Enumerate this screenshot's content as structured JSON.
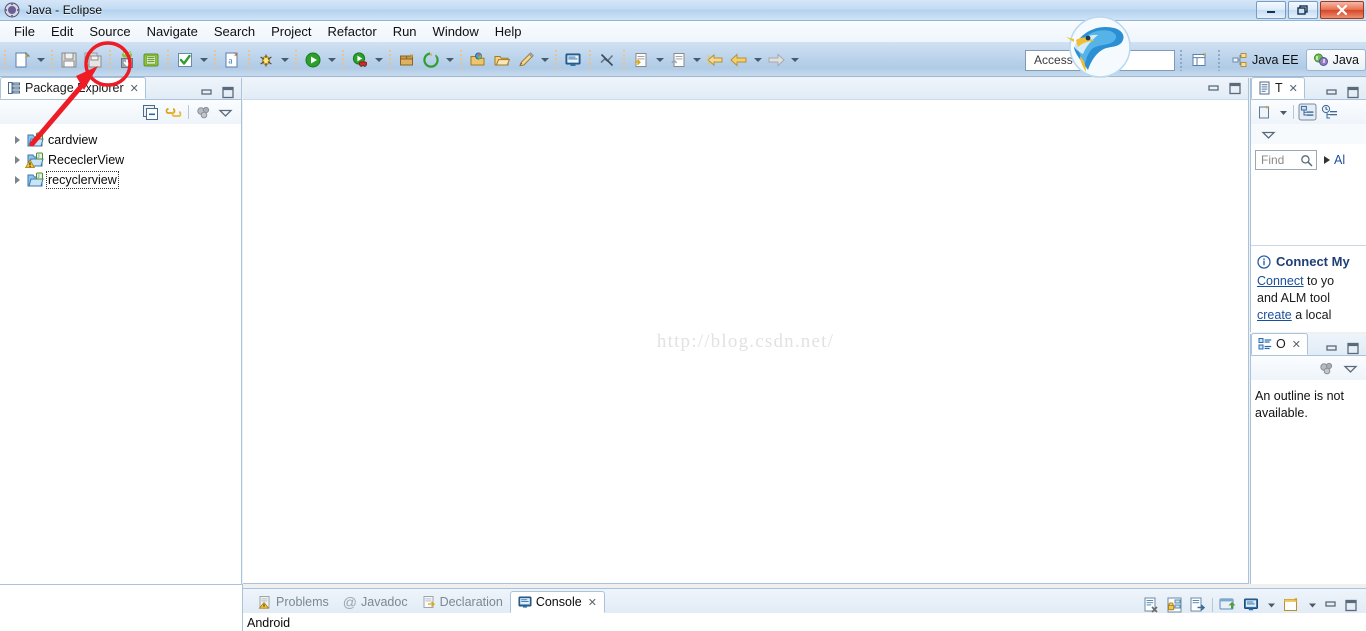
{
  "window": {
    "title": "Java - Eclipse",
    "icon": "eclipse-icon",
    "controls": {
      "minimize": "—",
      "restore": "❐",
      "close": "✕"
    }
  },
  "menubar": {
    "items": [
      {
        "label": "File"
      },
      {
        "label": "Edit"
      },
      {
        "label": "Source"
      },
      {
        "label": "Navigate"
      },
      {
        "label": "Search"
      },
      {
        "label": "Project"
      },
      {
        "label": "Refactor"
      },
      {
        "label": "Run"
      },
      {
        "label": "Window"
      },
      {
        "label": "Help"
      }
    ]
  },
  "toolbar": {
    "buttons": [
      {
        "name": "new-wizard-icon",
        "tooltip": "New"
      },
      {
        "name": "new-dropdown-arrow",
        "tooltip": "New menu"
      },
      {
        "name": "save-icon",
        "tooltip": "Save"
      },
      {
        "name": "save-all-icon",
        "tooltip": "Save All"
      },
      {
        "name": "android-sdk-manager-icon",
        "tooltip": "Android SDK Manager",
        "highlighted": true
      },
      {
        "name": "android-virtual-device-manager-icon",
        "tooltip": "Android Virtual Device Manager"
      },
      {
        "name": "build-all-icon",
        "tooltip": "Build All"
      },
      {
        "name": "build-dropdown-arrow",
        "tooltip": "Build menu"
      },
      {
        "name": "new-java-class-icon",
        "tooltip": "New Java Class"
      },
      {
        "name": "debug-icon",
        "tooltip": "Debug"
      },
      {
        "name": "debug-dropdown-arrow",
        "tooltip": "Debug menu"
      },
      {
        "name": "run-icon",
        "tooltip": "Run"
      },
      {
        "name": "run-dropdown-arrow",
        "tooltip": "Run menu"
      },
      {
        "name": "run-external-tools-icon",
        "tooltip": "External Tools"
      },
      {
        "name": "external-tools-dropdown-arrow",
        "tooltip": "External Tools menu"
      },
      {
        "name": "new-package-icon",
        "tooltip": "New Java Package"
      },
      {
        "name": "new-android-project-icon",
        "tooltip": "New Android Application Project"
      },
      {
        "name": "android-dropdown-arrow",
        "tooltip": "Android menu"
      },
      {
        "name": "open-type-icon",
        "tooltip": "Open Type"
      },
      {
        "name": "open-task-icon",
        "tooltip": "Open Task"
      },
      {
        "name": "pencil-icon",
        "tooltip": "Edit"
      },
      {
        "name": "pencil-dropdown-arrow",
        "tooltip": "Edit menu"
      },
      {
        "name": "open-console-icon",
        "tooltip": "Open Console"
      },
      {
        "name": "no-annotation-icon",
        "tooltip": "Toggle Annotations"
      },
      {
        "name": "next-annotation-icon",
        "tooltip": "Next Annotation"
      },
      {
        "name": "next-annotation-dropdown-arrow",
        "tooltip": "Next Annotation menu"
      },
      {
        "name": "previous-annotation-icon",
        "tooltip": "Previous Annotation"
      },
      {
        "name": "previous-annotation-dropdown-arrow",
        "tooltip": "Previous Annotation menu"
      },
      {
        "name": "back-to-icon",
        "tooltip": "Back To"
      },
      {
        "name": "back-icon",
        "tooltip": "Back"
      },
      {
        "name": "back-dropdown-arrow",
        "tooltip": "Back menu"
      },
      {
        "name": "forward-icon",
        "tooltip": "Forward"
      },
      {
        "name": "forward-dropdown-arrow",
        "tooltip": "Forward menu"
      }
    ]
  },
  "quick_access": {
    "placeholder": "Quick Access",
    "visible_text": "Access"
  },
  "perspectives": {
    "open_perspective_icon": "open-perspective-icon",
    "items": [
      {
        "label": "Java EE",
        "icon": "java-ee-perspective-icon",
        "active": false
      },
      {
        "label": "Java",
        "icon": "java-perspective-icon",
        "active": true
      }
    ]
  },
  "package_explorer": {
    "tab_label": "Package Explorer",
    "tab_icon": "package-explorer-icon",
    "close_glyph": "✕",
    "view_controls": [
      {
        "name": "collapse-all-icon"
      },
      {
        "name": "link-with-editor-icon"
      },
      {
        "name": "focus-on-active-task-icon"
      },
      {
        "name": "view-menu-icon"
      }
    ],
    "projects": [
      {
        "label": "cardview",
        "icon": "java-project-icon",
        "warning": false,
        "selected": false
      },
      {
        "label": "RececlerView",
        "icon": "java-project-icon",
        "warning": true,
        "selected": false
      },
      {
        "label": "recyclerview",
        "icon": "java-project-icon",
        "warning": false,
        "selected": true
      }
    ]
  },
  "editor": {
    "watermark": "http://blog.csdn.net/",
    "controls": [
      {
        "name": "minimize-icon"
      },
      {
        "name": "maximize-icon"
      }
    ]
  },
  "task_list": {
    "tab_label": "T",
    "tab_icon": "task-list-icon",
    "close_glyph": "✕",
    "toolbar": [
      {
        "name": "new-task-icon"
      },
      {
        "name": "new-task-dropdown-arrow"
      },
      {
        "name": "categorized-presentation-icon"
      },
      {
        "name": "scheduled-presentation-icon"
      },
      {
        "name": "view-menu-icon"
      }
    ],
    "find": {
      "placeholder": "Find",
      "value": "",
      "search_icon": "search-icon",
      "expand_icon": "expand-triangle-icon",
      "all_label": "Al"
    },
    "connect": {
      "info_icon": "info-icon",
      "title": "Connect My",
      "line1_link": "Connect",
      "line1_rest": " to yo",
      "line2": "and ALM tool",
      "line3_link": "create",
      "line3_rest": " a local"
    }
  },
  "outline": {
    "tab_label": "O",
    "tab_icon": "outline-icon",
    "close_glyph": "✕",
    "toolbar": [
      {
        "name": "focus-on-active-task-icon"
      },
      {
        "name": "view-menu-icon"
      }
    ],
    "message": "An outline is not available."
  },
  "bottom_panel": {
    "tabs": [
      {
        "label": "Problems",
        "icon": "problems-icon",
        "active": false
      },
      {
        "label": "Javadoc",
        "icon": "javadoc-icon",
        "active": false
      },
      {
        "label": "Declaration",
        "icon": "declaration-icon",
        "active": false
      },
      {
        "label": "Console",
        "icon": "console-icon",
        "active": true,
        "close_glyph": "✕"
      }
    ],
    "controls": [
      {
        "name": "clear-console-icon"
      },
      {
        "name": "scroll-lock-icon"
      },
      {
        "name": "pin-console-icon"
      },
      {
        "name": "display-selected-console-icon"
      },
      {
        "name": "open-console-icon"
      },
      {
        "name": "open-console-dropdown-arrow"
      },
      {
        "name": "new-console-view-icon"
      },
      {
        "name": "new-console-dropdown-arrow"
      },
      {
        "name": "minimize-icon"
      },
      {
        "name": "maximize-icon"
      }
    ],
    "console_text": "Android"
  },
  "annotations": {
    "circle_color": "#ee1c25",
    "arrow_color": "#ee1c25",
    "circle_target": "android-sdk-manager-icon"
  }
}
